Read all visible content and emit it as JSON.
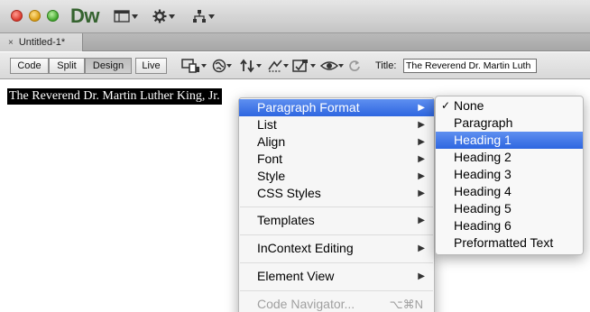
{
  "app": {
    "logo_text": "Dw",
    "doc_tab": "Untitled-1*",
    "doc_tab_close": "×"
  },
  "view_buttons": {
    "code": "Code",
    "split": "Split",
    "design": "Design",
    "live": "Live"
  },
  "title_field": {
    "label": "Title:",
    "value": "The Reverend Dr. Martin Luth"
  },
  "document": {
    "selected_text": "The Reverend Dr. Martin Luther King, Jr."
  },
  "context_menu": {
    "paragraph_format": "Paragraph Format",
    "list": "List",
    "align": "Align",
    "font": "Font",
    "style": "Style",
    "css_styles": "CSS Styles",
    "templates": "Templates",
    "incontext_editing": "InContext Editing",
    "element_view": "Element View",
    "code_navigator": "Code Navigator...",
    "code_navigator_shortcut": "⌥⌘N",
    "arrow": "▶"
  },
  "paragraph_submenu": {
    "check": "✓",
    "items": [
      "None",
      "Paragraph",
      "Heading 1",
      "Heading 2",
      "Heading 3",
      "Heading 4",
      "Heading 5",
      "Heading 6",
      "Preformatted Text"
    ],
    "checked": "None",
    "highlighted": "Heading 1"
  },
  "colors": {
    "highlight": "#3a72e6",
    "logo_green": "#35632f"
  }
}
